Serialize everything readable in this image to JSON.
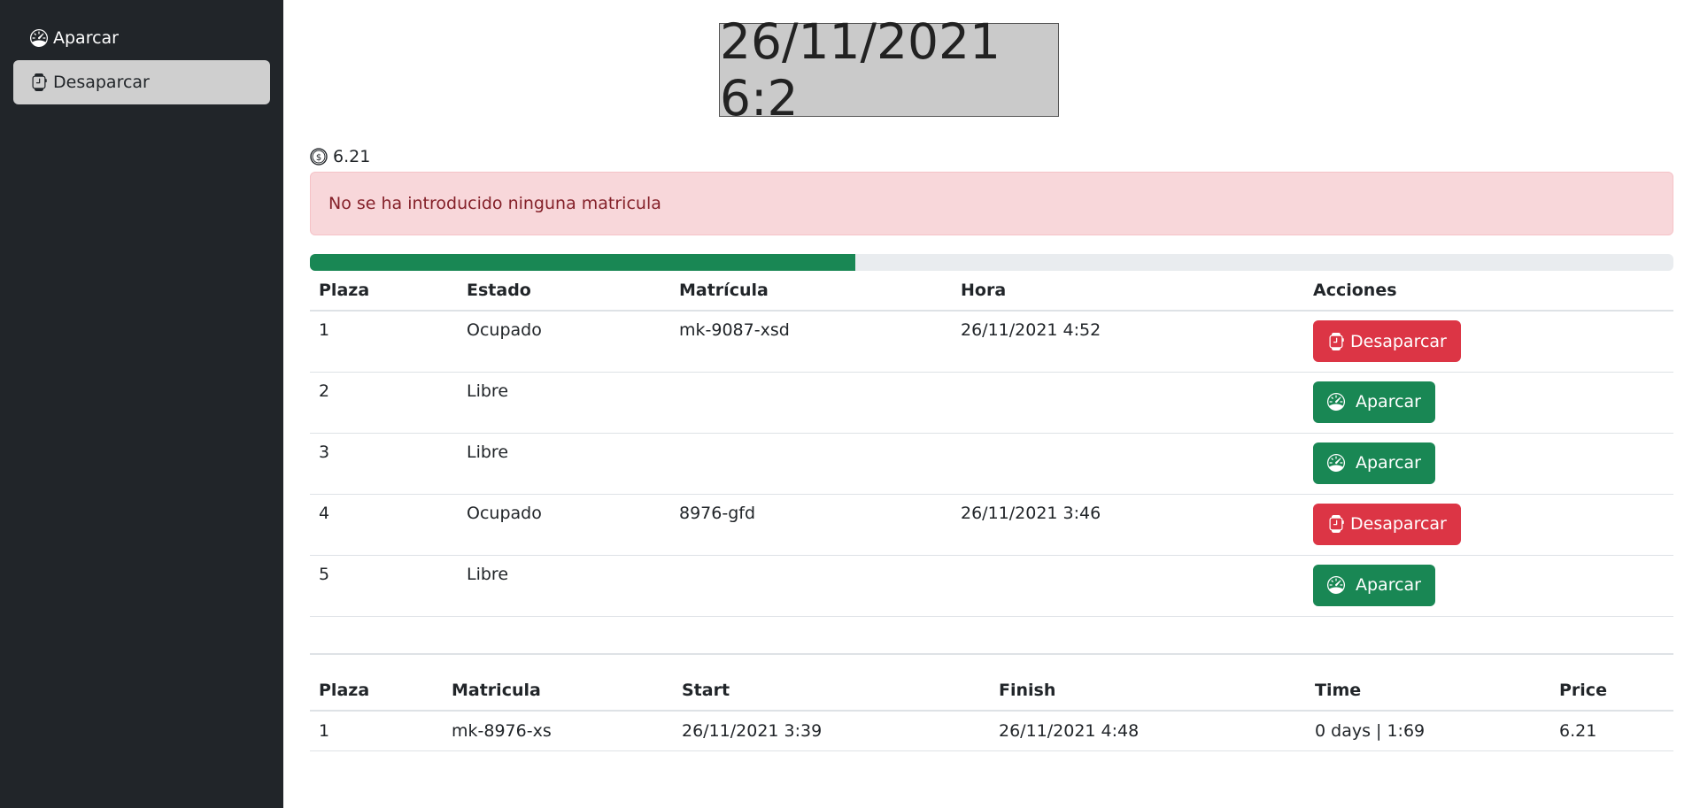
{
  "sidebar": {
    "items": [
      {
        "label": "Aparcar",
        "icon": "speedometer-icon",
        "active": false
      },
      {
        "label": "Desaparcar",
        "icon": "smartwatch-icon",
        "active": true
      }
    ]
  },
  "clock": {
    "text": "26/11/2021 6:2"
  },
  "earnings": {
    "icon": "coin-icon",
    "value": "6.21"
  },
  "alert": {
    "message": "No se ha introducido ninguna matricula"
  },
  "occupancy": {
    "fraction": 0.4,
    "color": "#198754"
  },
  "parking_table": {
    "headers": [
      "Plaza",
      "Estado",
      "Matrícula",
      "Hora",
      "Acciones"
    ],
    "rows": [
      {
        "plaza": "1",
        "estado": "Ocupado",
        "matricula": "mk-9087-xsd",
        "hora": "26/11/2021 4:52",
        "action": "Desaparcar"
      },
      {
        "plaza": "2",
        "estado": "Libre",
        "matricula": "",
        "hora": "",
        "action": "Aparcar"
      },
      {
        "plaza": "3",
        "estado": "Libre",
        "matricula": "",
        "hora": "",
        "action": "Aparcar"
      },
      {
        "plaza": "4",
        "estado": "Ocupado",
        "matricula": "8976-gfd",
        "hora": "26/11/2021 3:46",
        "action": "Desaparcar"
      },
      {
        "plaza": "5",
        "estado": "Libre",
        "matricula": "",
        "hora": "",
        "action": "Aparcar"
      }
    ]
  },
  "history_table": {
    "headers": [
      "Plaza",
      "Matricula",
      "Start",
      "Finish",
      "Time",
      "Price"
    ],
    "rows": [
      {
        "plaza": "1",
        "matricula": "mk-8976-xs",
        "start": "26/11/2021 3:39",
        "finish": "26/11/2021 4:48",
        "time": "0 days | 1:69",
        "price": "6.21"
      }
    ]
  },
  "colors": {
    "sidebar_bg": "#212529",
    "danger": "#dc3545",
    "success": "#198754",
    "alert_bg": "#f8d7da",
    "alert_text": "#842029"
  }
}
